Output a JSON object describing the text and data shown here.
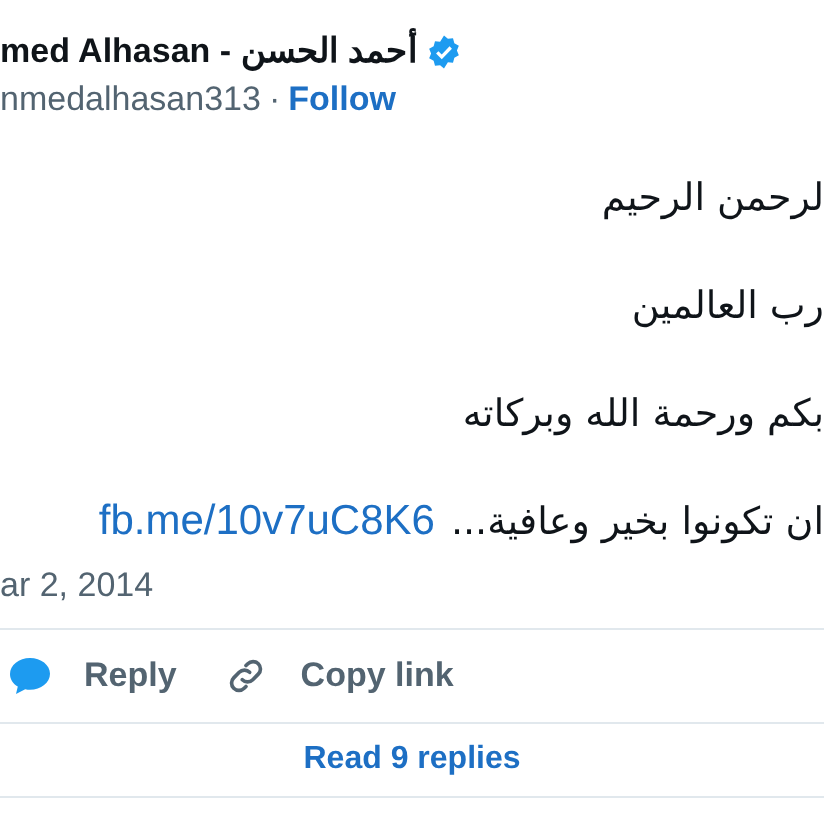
{
  "author": {
    "name": "med Alhasan - أحمد الحسن",
    "verified": true,
    "handle": "nmedalhasan313",
    "separator": "·",
    "follow": "Follow"
  },
  "tweet": {
    "lines": [
      "لرحمن الرحيم",
      "رب العالمين",
      "بكم ورحمة الله وبركاته",
      "ان تكونوا بخير وعافية..."
    ],
    "link": "fb.me/10v7uC8K6"
  },
  "date": "ar 2, 2014",
  "actions": {
    "reply": {
      "kind": "reply",
      "label": "Reply"
    },
    "copy_link": {
      "kind": "copy",
      "label": "Copy link"
    }
  },
  "read_replies": "Read 9 replies"
}
